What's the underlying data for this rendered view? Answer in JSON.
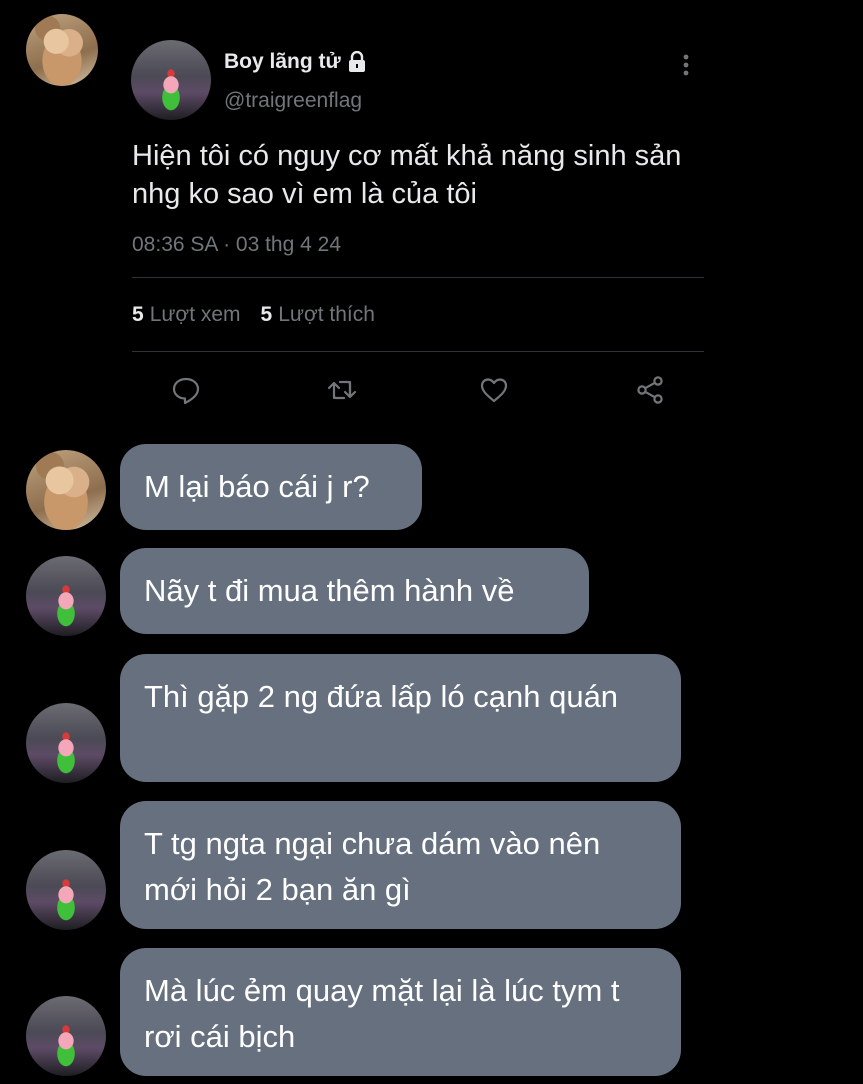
{
  "tweet": {
    "display_name": "Boy lãng tử",
    "handle": "@traigreenflag",
    "text": "Hiện tôi có nguy cơ mất khả năng sinh sản nhg ko sao vì em là của tôi",
    "timestamp": "08:36 SA · 03 thg 4 24",
    "views_count": "5",
    "views_label": "Lượt xem",
    "likes_count": "5",
    "likes_label": "Lượt thích",
    "icons": [
      "lock-icon",
      "more-icon",
      "reply-icon",
      "retweet-icon",
      "like-icon",
      "share-icon"
    ]
  },
  "messages": [
    {
      "sender": "hamster",
      "text": "M lại báo cái j r?"
    },
    {
      "sender": "patrick",
      "text": "Nãy t đi mua thêm hành về"
    },
    {
      "sender": "patrick",
      "text": "Thì gặp 2 ng đứa lấp ló cạnh quán"
    },
    {
      "sender": "patrick",
      "text": "T tg ngta ngại chưa dám vào nên mới hỏi 2 bạn ăn gì"
    },
    {
      "sender": "patrick",
      "text": "Mà lúc ẻm quay mặt lại là lúc tym t rơi cái bịch"
    }
  ],
  "colors": {
    "background": "#000000",
    "bubble": "#66707e",
    "secondary_text": "#71767b",
    "primary_text": "#e7e9ea"
  }
}
